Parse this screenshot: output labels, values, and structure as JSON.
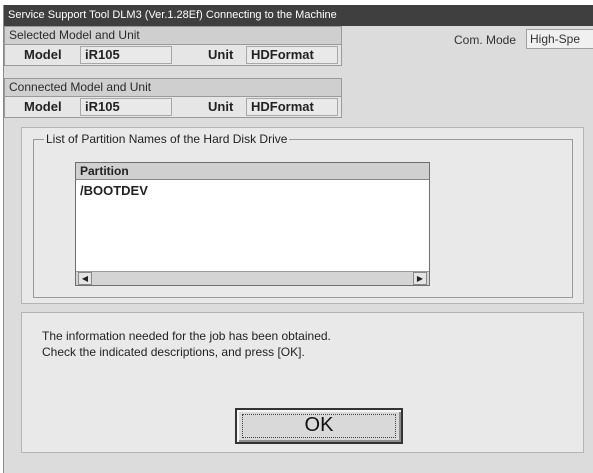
{
  "window": {
    "title": "Service Support Tool DLM3 (Ver.1.28Ef) Connecting to the Machine"
  },
  "selected": {
    "heading": "Selected Model and Unit",
    "model_label": "Model",
    "model_value": "iR105",
    "unit_label": "Unit",
    "unit_value": "HDFormat"
  },
  "com_mode": {
    "label": "Com. Mode",
    "value": "High-Spe"
  },
  "connected": {
    "heading": "Connected Model and Unit",
    "model_label": "Model",
    "model_value": "iR105",
    "unit_label": "Unit",
    "unit_value": "HDFormat"
  },
  "partitions": {
    "legend": "List of Partition Names of the Hard Disk Drive",
    "column_header": "Partition",
    "items": [
      "/BOOTDEV"
    ],
    "scroll_left_icon": "arrow-left-icon",
    "scroll_right_icon": "arrow-right-icon"
  },
  "message": {
    "line1": "The information needed for the job has been obtained.",
    "line2": "Check the indicated descriptions, and press [OK]."
  },
  "ok_button": {
    "label": "OK"
  }
}
